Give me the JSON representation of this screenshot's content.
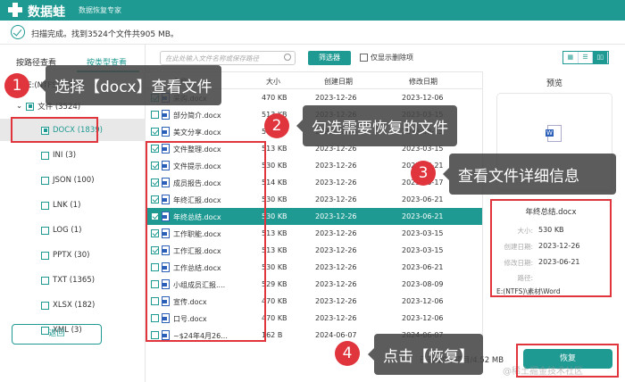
{
  "header": {
    "brand": "数据蛙",
    "tagline": "数据恢复专家"
  },
  "status": {
    "text": "扫描完成。找到3524个文件共905 MB。"
  },
  "left": {
    "tabs": [
      {
        "label": "按路径查看",
        "active": false
      },
      {
        "label": "按类型查看",
        "active": true
      }
    ],
    "tree_root": "E:(NTFS)(3524)",
    "tree_folder": "文件 (3524)",
    "types": [
      {
        "label": "DOCX (1839)",
        "state": "partial",
        "selected": true
      },
      {
        "label": "INI (3)",
        "state": "off"
      },
      {
        "label": "JSON (100)",
        "state": "off"
      },
      {
        "label": "LNK (1)",
        "state": "off"
      },
      {
        "label": "LOG (1)",
        "state": "off"
      },
      {
        "label": "PPTX (30)",
        "state": "off"
      },
      {
        "label": "TXT (1365)",
        "state": "off"
      },
      {
        "label": "XLSX (182)",
        "state": "off"
      },
      {
        "label": "XML (3)",
        "state": "off"
      }
    ],
    "back_label": "返回"
  },
  "toolbar": {
    "search_placeholder": "在此处输入文件名称或保存路径",
    "filter_label": "筛选器",
    "deleted_only_label": "仅显示删除项",
    "views": [
      "grid-icon",
      "list-icon",
      "detail-icon"
    ]
  },
  "table": {
    "columns": [
      "名称",
      "大小",
      "创建日期",
      "修改日期"
    ],
    "rows": [
      {
        "name": "采购.docx",
        "size": "470 KB",
        "created": "2023-12-26",
        "modified": "2023-12-06",
        "checked": true
      },
      {
        "name": "部分简介.docx",
        "size": "513 KB",
        "created": "2023-12-26",
        "modified": "2023-03-15",
        "checked": false
      },
      {
        "name": "美文分享.docx",
        "size": "513 KB",
        "created": "2023-12-26",
        "modified": "2023-03-15",
        "checked": true
      },
      {
        "name": "文件整理.docx",
        "size": "513 KB",
        "created": "2023-12-26",
        "modified": "2023-03-15",
        "checked": true
      },
      {
        "name": "文件提示.docx",
        "size": "530 KB",
        "created": "2023-12-26",
        "modified": "2023-06-21",
        "checked": true
      },
      {
        "name": "成员报告.docx",
        "size": "514 KB",
        "created": "2023-12-26",
        "modified": "2023-10-17",
        "checked": true
      },
      {
        "name": "年终汇报.docx",
        "size": "530 KB",
        "created": "2023-12-26",
        "modified": "2023-06-21",
        "checked": true
      },
      {
        "name": "年终总结.docx",
        "size": "530 KB",
        "created": "2023-12-26",
        "modified": "2023-06-21",
        "checked": true,
        "selected": true
      },
      {
        "name": "工作职能.docx",
        "size": "513 KB",
        "created": "2023-12-26",
        "modified": "2023-03-15",
        "checked": true
      },
      {
        "name": "工作汇报.docx",
        "size": "513 KB",
        "created": "2023-12-26",
        "modified": "2023-03-15",
        "checked": true
      },
      {
        "name": "工作总结.docx",
        "size": "530 KB",
        "created": "2023-12-26",
        "modified": "2023-06-21",
        "checked": false
      },
      {
        "name": "小组成员汇报....",
        "size": "529 KB",
        "created": "2023-12-26",
        "modified": "2023-08-09",
        "checked": false
      },
      {
        "name": "宣传.docx",
        "size": "470 KB",
        "created": "2023-12-26",
        "modified": "2023-12-06",
        "checked": false
      },
      {
        "name": "口号.docx",
        "size": "470 KB",
        "created": "2023-12-26",
        "modified": "2023-12-06",
        "checked": false
      },
      {
        "name": "~$24年4月26...",
        "size": "162  B",
        "created": "2024-06-07",
        "modified": "2024-06-07",
        "checked": false
      }
    ]
  },
  "preview": {
    "title": "预览",
    "file_name": "年终总结.docx",
    "size_label": "大小:",
    "size": "530 KB",
    "created_label": "创建日期:",
    "created": "2023-12-26",
    "modified_label": "修改日期:",
    "modified": "2023-06-21",
    "path_label": "路径:",
    "path": "E:(NTFS)\\素材\\Word"
  },
  "footer": {
    "selected_text": "已选择9个项目/4.52 MB",
    "recover_label": "恢复",
    "watermark": "@稀土掘金技术社区"
  },
  "callouts": [
    {
      "num": "1",
      "text": "选择【docx】查看文件"
    },
    {
      "num": "2",
      "text": "勾选需要恢复的文件"
    },
    {
      "num": "3",
      "text": "查看文件详细信息"
    },
    {
      "num": "4",
      "text": "点击【恢复】"
    }
  ],
  "colors": {
    "accent": "#1f9a92",
    "highlight": "#e0353d"
  }
}
